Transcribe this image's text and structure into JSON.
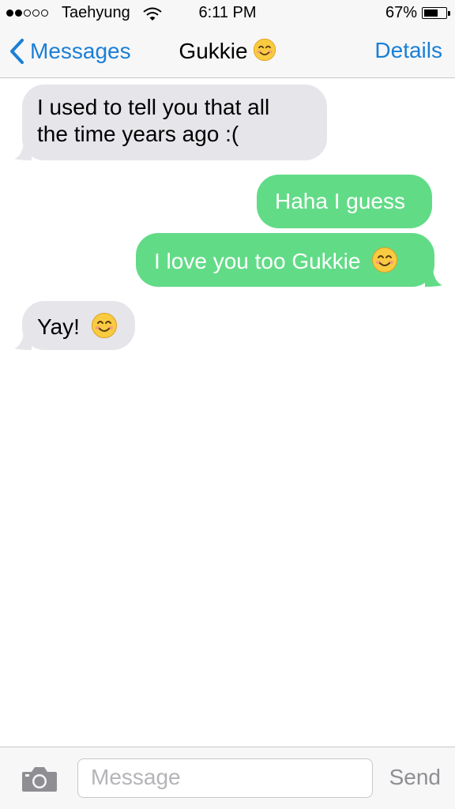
{
  "status": {
    "carrier": "Taehyung",
    "time": "6:11 PM",
    "battery": "67%",
    "battery_level": 0.67,
    "signal_bars": 2
  },
  "nav": {
    "back_label": "Messages",
    "title": "Gukkie",
    "details_label": "Details"
  },
  "messages": [
    {
      "from": "them",
      "line1": "I used to tell you that all",
      "line2": "the time years ago :("
    },
    {
      "from": "me",
      "text": "Haha I guess"
    },
    {
      "from": "me",
      "text": "I love you too Gukkie",
      "emoji": "smiling-face-emoji"
    },
    {
      "from": "them",
      "text": "Yay!",
      "emoji": "smiling-face-emoji"
    }
  ],
  "input": {
    "placeholder": "Message",
    "send_label": "Send"
  },
  "colors": {
    "accent": "#1a7fd6",
    "incoming_bubble": "#e5e5ea",
    "outgoing_bubble": "#62db87",
    "bar_background": "#f7f7f8"
  }
}
